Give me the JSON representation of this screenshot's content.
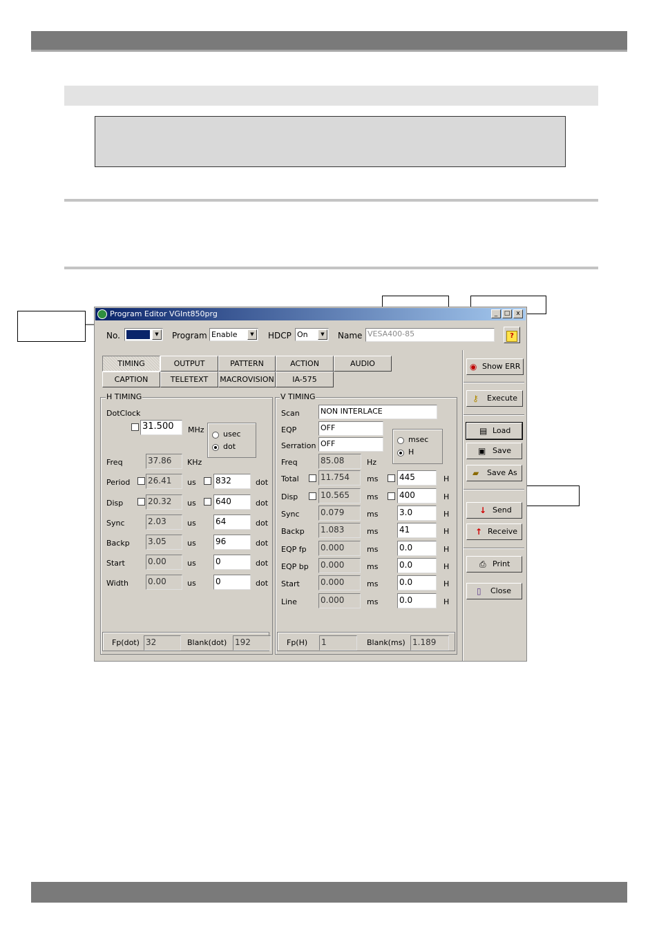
{
  "window": {
    "title": "Program Editor VGInt850prg",
    "min_glyph": "_",
    "max_glyph": "□",
    "close_glyph": "x"
  },
  "header": {
    "no_label": "No.",
    "no_value": "",
    "program_label": "Program",
    "program_value": "Enable",
    "hdcp_label": "HDCP",
    "hdcp_value": "On",
    "name_label": "Name",
    "name_value": "VESA400-85",
    "help_glyph": "?"
  },
  "tabs": [
    "TIMING",
    "OUTPUT",
    "PATTERN",
    "ACTION",
    "AUDIO",
    "CAPTION",
    "TELETEXT",
    "MACROVISION",
    "IA-575"
  ],
  "h_timing": {
    "title": "H TIMING",
    "dotclock_label": "DotClock",
    "dotclock_value": "31.500",
    "dotclock_unit": "MHz",
    "radio_usec": "usec",
    "radio_dot": "dot",
    "selected_unit": "dot",
    "rows": [
      {
        "label": "Freq",
        "value": "37.86",
        "unit": "KHz"
      },
      {
        "label": "Period",
        "value": "26.41",
        "unit": "us",
        "dots": "832",
        "dot_unit": "dot"
      },
      {
        "label": "Disp",
        "value": "20.32",
        "unit": "us",
        "dots": "640",
        "dot_unit": "dot"
      },
      {
        "label": "Sync",
        "value": "2.03",
        "unit": "us",
        "dots": "64",
        "dot_unit": "dot"
      },
      {
        "label": "Backp",
        "value": "3.05",
        "unit": "us",
        "dots": "96",
        "dot_unit": "dot"
      },
      {
        "label": "Start",
        "value": "0.00",
        "unit": "us",
        "dots": "0",
        "dot_unit": "dot"
      },
      {
        "label": "Width",
        "value": "0.00",
        "unit": "us",
        "dots": "0",
        "dot_unit": "dot"
      }
    ],
    "fp_label": "Fp(dot)",
    "fp_value": "32",
    "blank_label": "Blank(dot)",
    "blank_value": "192"
  },
  "v_timing": {
    "title": "V TIMING",
    "scan_label": "Scan",
    "scan_value": "NON INTERLACE",
    "eqp_label": "EQP",
    "eqp_value": "OFF",
    "serration_label": "Serration",
    "serration_value": "OFF",
    "radio_msec": "msec",
    "radio_h": "H",
    "selected_unit": "H",
    "freq_label": "Freq",
    "freq_value": "85.08",
    "freq_unit": "Hz",
    "rows": [
      {
        "label": "Total",
        "value": "11.754",
        "unit": "ms",
        "lines": "445",
        "line_unit": "H",
        "check": true
      },
      {
        "label": "Disp",
        "value": "10.565",
        "unit": "ms",
        "lines": "400",
        "line_unit": "H",
        "check": true
      },
      {
        "label": "Sync",
        "value": "0.079",
        "unit": "ms",
        "lines": "3.0",
        "line_unit": "H"
      },
      {
        "label": "Backp",
        "value": "1.083",
        "unit": "ms",
        "lines": "41",
        "line_unit": "H"
      },
      {
        "label": "EQP fp",
        "value": "0.000",
        "unit": "ms",
        "lines": "0.0",
        "line_unit": "H"
      },
      {
        "label": "EQP bp",
        "value": "0.000",
        "unit": "ms",
        "lines": "0.0",
        "line_unit": "H"
      },
      {
        "label": "Start",
        "value": "0.000",
        "unit": "ms",
        "lines": "0.0",
        "line_unit": "H"
      },
      {
        "label": "Line",
        "value": "0.000",
        "unit": "ms",
        "lines": "0.0",
        "line_unit": "H"
      }
    ],
    "fp_label": "Fp(H)",
    "fp_value": "1",
    "blank_label": "Blank(ms)",
    "blank_value": "1.189"
  },
  "side_buttons": {
    "show_err": "Show ERR",
    "execute": "Execute",
    "load": "Load",
    "save": "Save",
    "save_as": "Save As",
    "send": "Send",
    "receive": "Receive",
    "print": "Print",
    "close": "Close"
  },
  "icons": {
    "show_err": "red-circle-icon",
    "execute": "key-icon",
    "load": "document-icon",
    "save": "floppy-icon",
    "save_as": "folder-icon",
    "send": "down-arrow-icon",
    "receive": "up-arrow-icon",
    "print": "printer-icon",
    "close": "door-icon"
  }
}
